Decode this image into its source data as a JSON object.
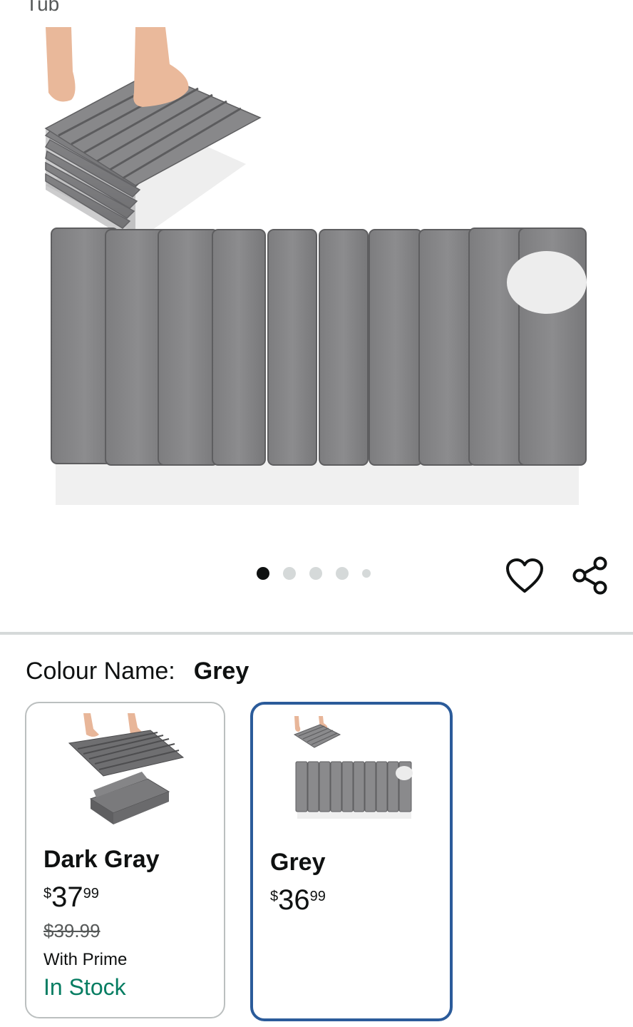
{
  "header": {
    "title_fragment": "Tub"
  },
  "gallery": {
    "image_count": 5,
    "active_index": 0,
    "wishlist_icon": "heart-outline-icon",
    "share_icon": "share-icon"
  },
  "variation": {
    "label": "Colour Name:",
    "selected_value": "Grey",
    "options": [
      {
        "name": "Dark Gray",
        "price_symbol": "$",
        "price_whole": "37",
        "price_fraction": "99",
        "list_price": "$39.99",
        "prime_text": "With Prime",
        "availability": "In Stock",
        "selected": false
      },
      {
        "name": "Grey",
        "price_symbol": "$",
        "price_whole": "36",
        "price_fraction": "99",
        "selected": true
      }
    ]
  },
  "colors": {
    "selected_border": "#2b5b9a",
    "in_stock": "#067d62",
    "dot_active": "#0f1111",
    "dot_inactive": "#d5d9d9"
  }
}
